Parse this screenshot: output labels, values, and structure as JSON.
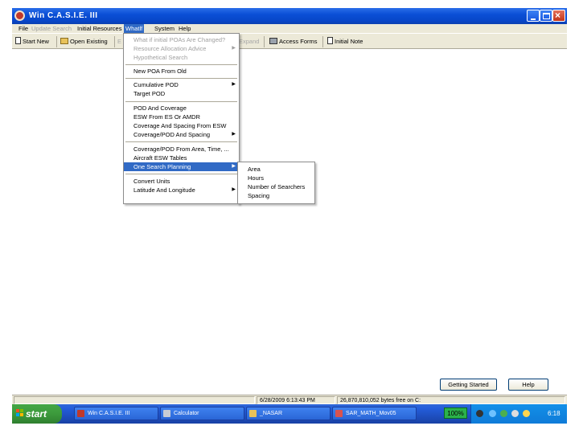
{
  "window": {
    "title": "Win C.A.S.I.E. III"
  },
  "menubar": {
    "items": [
      {
        "label": "File",
        "disabled": false
      },
      {
        "label": "Update Search",
        "disabled": true
      },
      {
        "label": "Initial Resources",
        "disabled": false
      },
      {
        "label": "Whatlf",
        "disabled": false,
        "active": true
      },
      {
        "label": "System",
        "disabled": false
      },
      {
        "label": "Help",
        "disabled": false
      }
    ]
  },
  "toolbar": {
    "start_new": "Start New",
    "open_existing": "Open Existing",
    "hidden_left": "E",
    "hidden_mid": "Expand",
    "access_forms": "Access Forms",
    "initial_note": "Initial Note"
  },
  "dropdown": {
    "items": [
      {
        "label": "What if initial POAs Are Changed?",
        "disabled": true,
        "submenu": false
      },
      {
        "label": "Resource Allocation Advice",
        "disabled": true,
        "submenu": true
      },
      {
        "label": "Hypothetical Search",
        "disabled": true,
        "submenu": false
      },
      {
        "label": "New POA From Old",
        "disabled": false,
        "submenu": false
      },
      {
        "label": "Cumulative POD",
        "disabled": false,
        "submenu": true
      },
      {
        "label": "Target POD",
        "disabled": false,
        "submenu": false
      },
      {
        "label": "POD And Coverage",
        "disabled": false,
        "submenu": false
      },
      {
        "label": "ESW From ES Or AMDR",
        "disabled": false,
        "submenu": false
      },
      {
        "label": "Coverage And Spacing From ESW",
        "disabled": false,
        "submenu": false
      },
      {
        "label": "Coverage/POD And Spacing",
        "disabled": false,
        "submenu": true
      },
      {
        "label": "Coverage/POD From Area, Time, ...",
        "disabled": false,
        "submenu": false
      },
      {
        "label": "Aircraft ESW Tables",
        "disabled": false,
        "submenu": false
      },
      {
        "label": "One Search Planning",
        "disabled": false,
        "submenu": true,
        "active": true
      },
      {
        "label": "Convert Units",
        "disabled": false,
        "submenu": false
      },
      {
        "label": "Latitude And Longitude",
        "disabled": false,
        "submenu": true
      }
    ]
  },
  "submenu": {
    "items": [
      "Area",
      "Hours",
      "Number of Searchers",
      "Spacing"
    ]
  },
  "buttons": {
    "getting_started": "Getting Started",
    "help": "Help"
  },
  "statusbar": {
    "datetime": "6/28/2009 6:13:43 PM",
    "info": "26,870,810,052 bytes free on C:"
  },
  "taskbar": {
    "start": "start",
    "tasks": [
      "Win C.A.S.I.E. III",
      "Calculator",
      "_NASAR",
      "SAR_MATH_Mov05"
    ],
    "battery": "100%",
    "clock": "6:18 PM"
  }
}
